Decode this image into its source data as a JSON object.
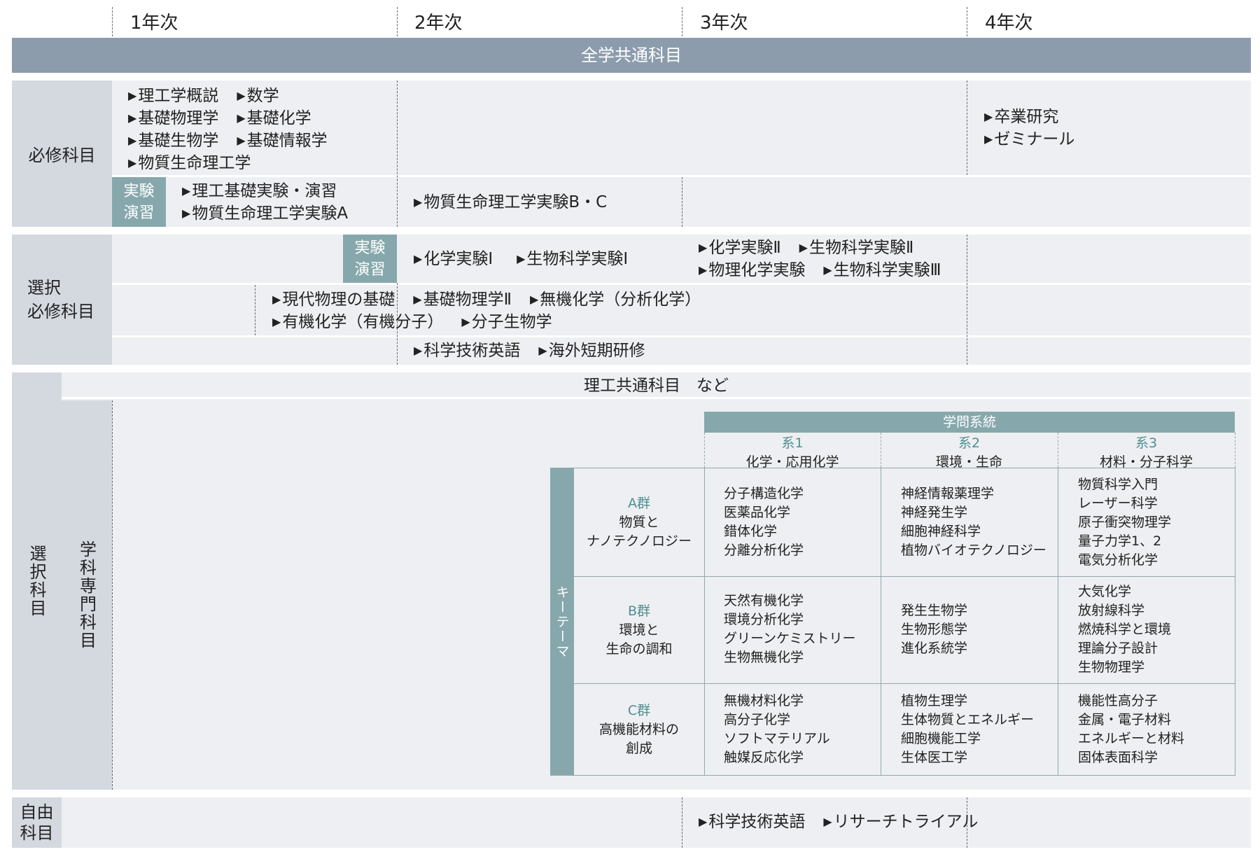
{
  "years": [
    "1年次",
    "2年次",
    "3年次",
    "4年次"
  ],
  "common_header": "全学共通科目",
  "required": {
    "label": "必修科目",
    "courses": [
      [
        "理工学概説",
        "数学"
      ],
      [
        "基礎物理学",
        "基礎化学"
      ],
      [
        "基礎生物学",
        "基礎情報学"
      ],
      [
        "物質生命理工学"
      ]
    ],
    "senior_courses": [
      "卒業研究",
      "ゼミナール"
    ],
    "lab_tag": [
      "実験",
      "演習"
    ],
    "lab_year1": [
      "理工基礎実験・演習",
      "物質生命理工学実験A"
    ],
    "lab_year2": [
      "物質生命理工学実験B・C"
    ]
  },
  "elective_required": {
    "label": [
      "選択",
      "必修科目"
    ],
    "lab_tag": [
      "実験",
      "演習"
    ],
    "lab_year2": [
      "化学実験Ⅰ",
      "生物科学実験Ⅰ"
    ],
    "lab_year3": [
      [
        "化学実験Ⅱ",
        "生物科学実験Ⅱ"
      ],
      [
        "物理化学実験",
        "生物科学実験Ⅲ"
      ]
    ],
    "lecture_rows": [
      [
        "現代物理の基礎",
        "基礎物理学Ⅱ",
        "無機化学（分析化学）"
      ],
      [
        "有機化学（有機分子）",
        "分子生物学"
      ]
    ],
    "language_row": [
      "科学技術英語",
      "海外短期研修"
    ]
  },
  "elective": {
    "label": "選択科目",
    "common_subjects": "理工共通科目　など",
    "dept_label": "学科専門科目",
    "key_theme": "キーテーマ",
    "discipline_header": "学問系統",
    "systems": [
      {
        "code": "系1",
        "name": "化学・応用化学"
      },
      {
        "code": "系2",
        "name": "環境・生命"
      },
      {
        "code": "系3",
        "name": "材料・分子科学"
      }
    ],
    "groups": [
      {
        "code": "A群",
        "name": [
          "物質と",
          "ナノテクノロジー"
        ],
        "cells": [
          [
            "分子構造化学",
            "医薬品化学",
            "錯体化学",
            "分離分析化学"
          ],
          [
            "神経情報薬理学",
            "神経発生学",
            "細胞神経科学",
            "植物バイオテクノロジー"
          ],
          [
            "物質科学入門",
            "レーザー科学",
            "原子衝突物理学",
            "量子力学1、2",
            "電気分析化学"
          ]
        ]
      },
      {
        "code": "B群",
        "name": [
          "環境と",
          "生命の調和"
        ],
        "cells": [
          [
            "天然有機化学",
            "環境分析化学",
            "グリーンケミストリー",
            "生物無機化学"
          ],
          [
            "発生生物学",
            "生物形態学",
            "進化系統学"
          ],
          [
            "大気化学",
            "放射線科学",
            "燃焼科学と環境",
            "理論分子設計",
            "生物物理学"
          ]
        ]
      },
      {
        "code": "C群",
        "name": [
          "高機能材料の",
          "創成"
        ],
        "cells": [
          [
            "無機材料化学",
            "高分子化学",
            "ソフトマテリアル",
            "触媒反応化学"
          ],
          [
            "植物生理学",
            "生体物質とエネルギー",
            "細胞機能工学",
            "生体医工学"
          ],
          [
            "機能性高分子",
            "金属・電子材料",
            "エネルギーと材料",
            "固体表面科学"
          ]
        ]
      }
    ]
  },
  "free": {
    "label": [
      "自由",
      "科目"
    ],
    "courses": [
      "科学技術英語",
      "リサーチトライアル"
    ]
  }
}
